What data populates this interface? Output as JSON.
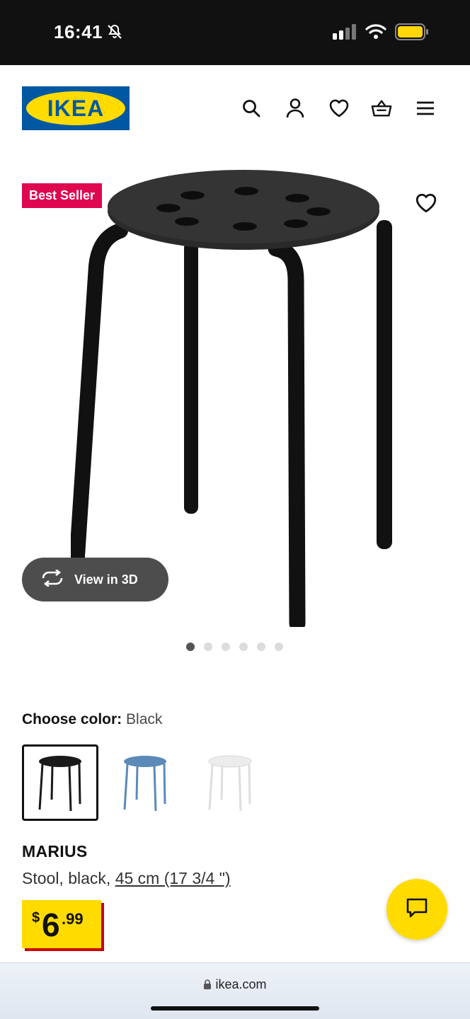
{
  "status_bar": {
    "time": "16:41"
  },
  "header": {
    "logo_text": "IKEA",
    "icons": [
      "search-icon",
      "account-icon",
      "heart-icon",
      "cart-icon",
      "menu-icon"
    ]
  },
  "gallery": {
    "badge": "Best Seller",
    "view_3d_label": "View in 3D",
    "image_count": 6,
    "active_index": 0
  },
  "color": {
    "label": "Choose color:",
    "value": "Black",
    "options": [
      {
        "name": "Black",
        "hex": "#1a1a1a",
        "selected": true
      },
      {
        "name": "Blue",
        "hex": "#5b8ab8",
        "selected": false
      },
      {
        "name": "White",
        "hex": "#e6e6e6",
        "selected": false
      }
    ]
  },
  "product": {
    "name": "MARIUS",
    "desc_prefix": "Stool, black, ",
    "size_link": "45 cm (17 3/4 \")",
    "price_currency": "$",
    "price_integer": "6",
    "price_decimal": ".99"
  },
  "browser": {
    "url": "ikea.com"
  },
  "colors": {
    "ikea_blue": "#0058a3",
    "ikea_yellow": "#ffdb00",
    "badge_red": "#e00751"
  }
}
